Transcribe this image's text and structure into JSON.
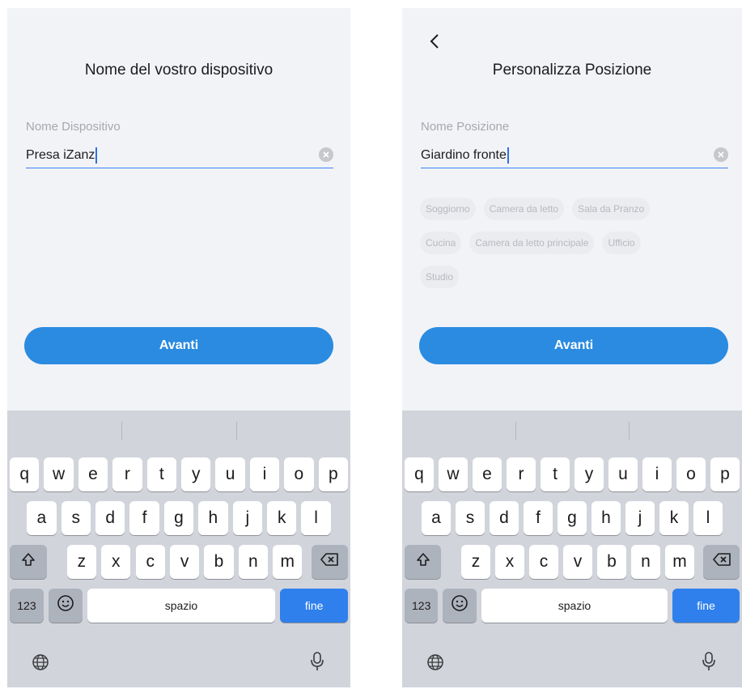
{
  "screens": [
    {
      "title": "Nome del vostro dispositivo",
      "field_label": "Nome Dispositivo",
      "field_value": "Presa iZanz",
      "button_label": "Avanti"
    },
    {
      "title": "Personalizza Posizione",
      "field_label": "Nome Posizione",
      "field_value": "Giardino fronte",
      "chips": [
        "Soggiorno",
        "Camera da letto",
        "Sala da Pranzo",
        "Cucina",
        "Camera da letto principale",
        "Ufficio",
        "Studio"
      ],
      "button_label": "Avanti"
    }
  ],
  "keyboard": {
    "row1": [
      "q",
      "w",
      "e",
      "r",
      "t",
      "y",
      "u",
      "i",
      "o",
      "p"
    ],
    "row2": [
      "a",
      "s",
      "d",
      "f",
      "g",
      "h",
      "j",
      "k",
      "l"
    ],
    "row3": [
      "z",
      "x",
      "c",
      "v",
      "b",
      "n",
      "m"
    ],
    "numbers_label": "123",
    "space_label": "spazio",
    "done_label": "fine"
  },
  "colors": {
    "accent": "#2a8be0",
    "background": "#f2f3f7",
    "keyboard": "#d1d4db"
  },
  "icons": [
    "chevron-left-icon",
    "clear-icon",
    "shift-icon",
    "backspace-icon",
    "emoji-icon",
    "globe-icon",
    "microphone-icon"
  ]
}
